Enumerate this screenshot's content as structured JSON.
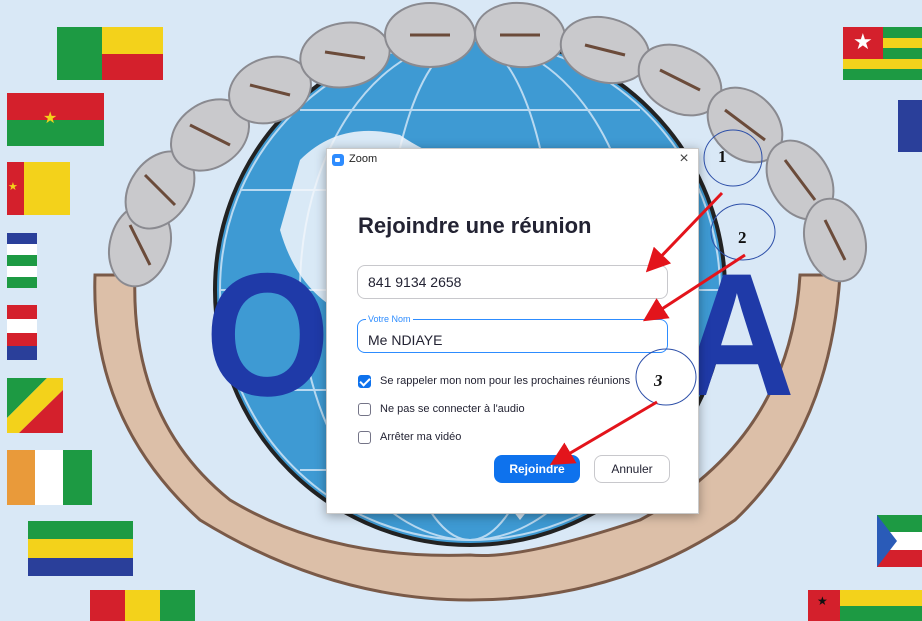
{
  "window": {
    "title": "Zoom"
  },
  "dialog": {
    "heading": "Rejoindre une réunion",
    "meeting_id_value": "841 9134 2658",
    "name_label": "Votre Nom",
    "name_value": "Me NDIAYE",
    "options": [
      {
        "label": "Se rappeler mon nom pour les prochaines réunions",
        "checked": true
      },
      {
        "label": "Ne pas se connecter à l'audio",
        "checked": false
      },
      {
        "label": "Arrêter ma vidéo",
        "checked": false
      }
    ],
    "join_label": "Rejoindre",
    "cancel_label": "Annuler"
  },
  "annotations": {
    "step1": "1",
    "step2": "2",
    "step3": "3"
  },
  "background": {
    "logo_text": "OHADA"
  },
  "colors": {
    "accent": "#0e72ed",
    "arrow": "#e3141b",
    "logo": "#1f3aa8",
    "hand": "#dcbfa8"
  },
  "icons": {
    "app": "zoom-icon",
    "close": "close-icon",
    "check": "checkmark-icon"
  }
}
